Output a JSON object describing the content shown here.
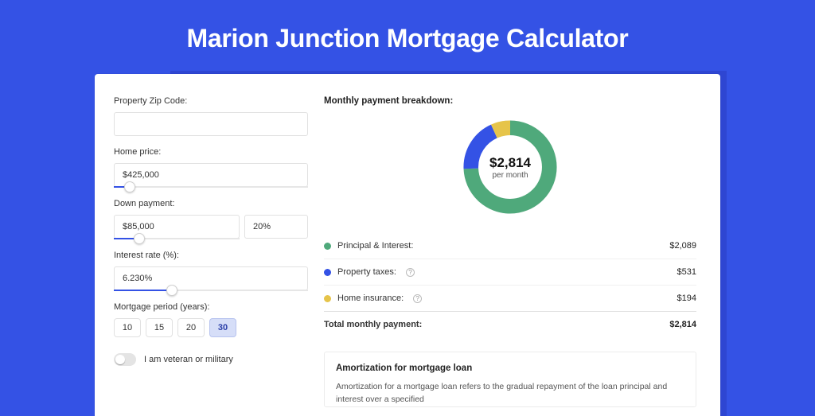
{
  "title": "Marion Junction Mortgage Calculator",
  "form": {
    "zip_label": "Property Zip Code:",
    "zip_value": "",
    "home_price_label": "Home price:",
    "home_price_value": "$425,000",
    "home_price_slider_pct": 8,
    "down_payment_label": "Down payment:",
    "down_payment_value": "$85,000",
    "down_payment_pct_value": "20%",
    "down_payment_slider_pct": 20,
    "interest_label": "Interest rate (%):",
    "interest_value": "6.230%",
    "interest_slider_pct": 30,
    "period_label": "Mortgage period (years):",
    "periods": [
      "10",
      "15",
      "20",
      "30"
    ],
    "period_selected": "30",
    "veteran_label": "I am veteran or military"
  },
  "breakdown": {
    "section_title": "Monthly payment breakdown:",
    "center_value": "$2,814",
    "center_sub": "per month",
    "items": [
      {
        "label": "Principal & Interest:",
        "value": "$2,089",
        "color": "green",
        "info": false
      },
      {
        "label": "Property taxes:",
        "value": "$531",
        "color": "blue",
        "info": true
      },
      {
        "label": "Home insurance:",
        "value": "$194",
        "color": "yellow",
        "info": true
      }
    ],
    "total_label": "Total monthly payment:",
    "total_value": "$2,814"
  },
  "chart_data": {
    "type": "pie",
    "title": "Monthly payment breakdown",
    "series": [
      {
        "name": "Principal & Interest",
        "value": 2089,
        "color": "#4fa97b"
      },
      {
        "name": "Property taxes",
        "value": 531,
        "color": "#3452e5"
      },
      {
        "name": "Home insurance",
        "value": 194,
        "color": "#e6c44a"
      }
    ],
    "total": 2814,
    "center_label": "$2,814 per month"
  },
  "amortization": {
    "title": "Amortization for mortgage loan",
    "text": "Amortization for a mortgage loan refers to the gradual repayment of the loan principal and interest over a specified"
  }
}
